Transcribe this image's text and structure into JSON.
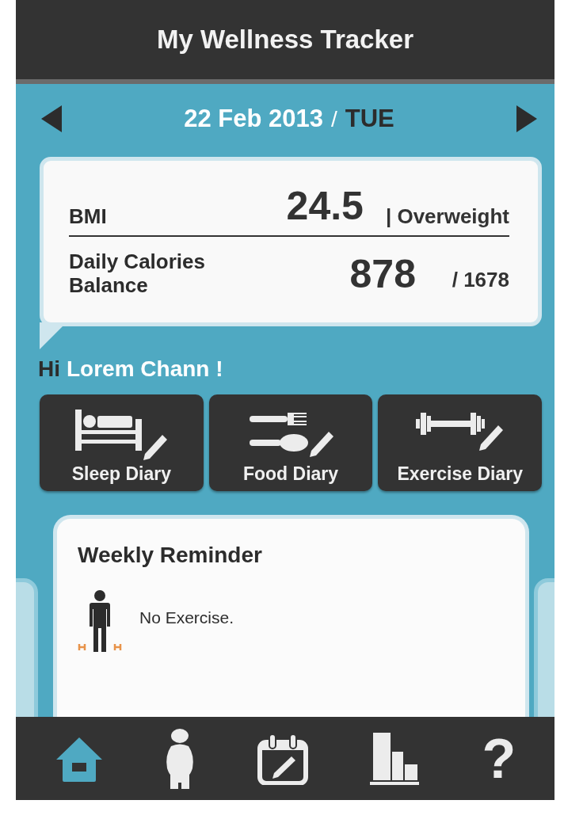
{
  "header": {
    "title": "My Wellness Tracker"
  },
  "date_bar": {
    "date": "22 Feb 2013",
    "separator": "/",
    "weekday": "TUE"
  },
  "summary": {
    "rows": [
      {
        "label": "BMI",
        "value": "24.5",
        "note": "| Overweight"
      },
      {
        "label": "Daily Calories Balance",
        "value": "878",
        "note": "/ 1678"
      }
    ]
  },
  "greeting": {
    "prefix": "Hi",
    "name": "Lorem Chann !"
  },
  "diaries": [
    {
      "kind": "sleep",
      "label": "Sleep Diary"
    },
    {
      "kind": "food",
      "label": "Food Diary"
    },
    {
      "kind": "exercise",
      "label": "Exercise Diary"
    }
  ],
  "reminder": {
    "title": "Weekly Reminder",
    "message": "No Exercise."
  },
  "nav": [
    {
      "kind": "home",
      "selected": true
    },
    {
      "kind": "body",
      "selected": false
    },
    {
      "kind": "calendar",
      "selected": false
    },
    {
      "kind": "stats",
      "selected": false
    },
    {
      "kind": "help",
      "glyph": "?",
      "selected": false
    }
  ]
}
